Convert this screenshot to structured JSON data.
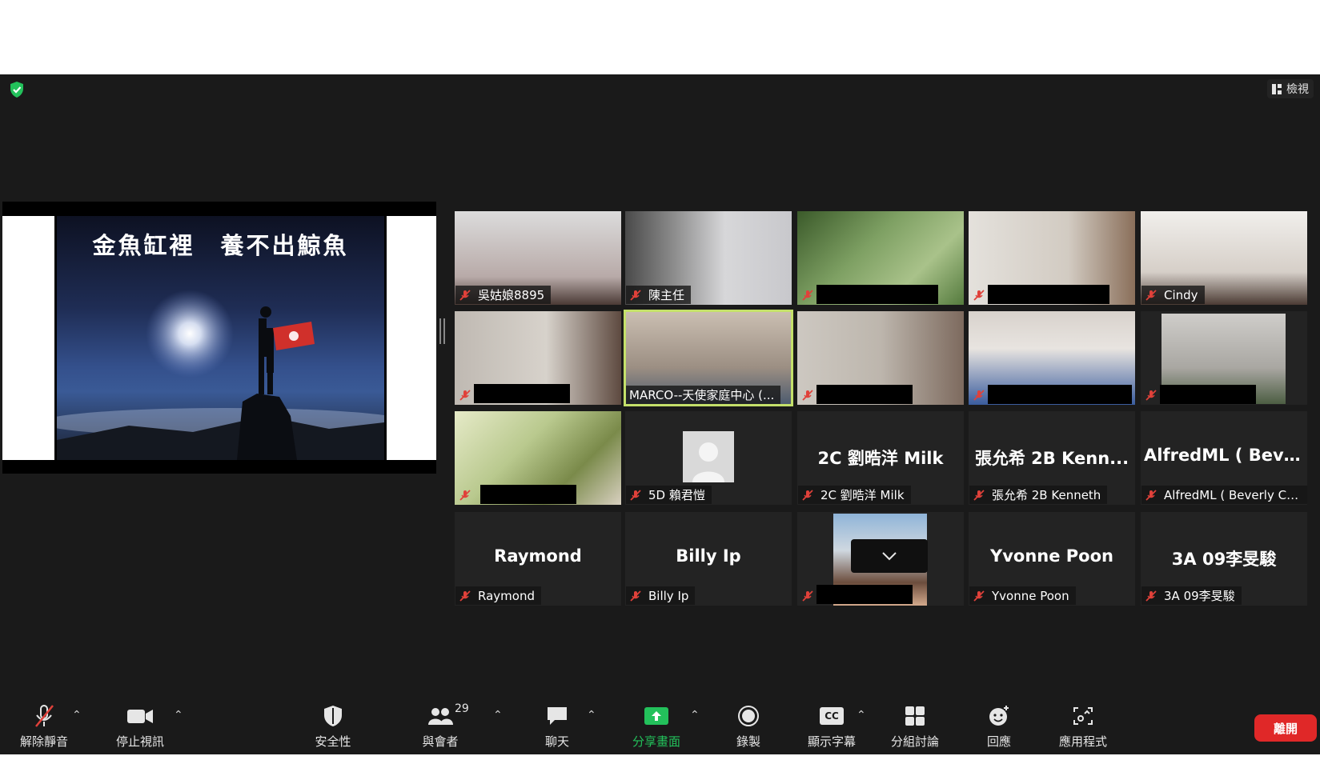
{
  "app": {
    "view_label": "檢視"
  },
  "share": {
    "slide_title": "金魚缸裡　養不出鯨魚"
  },
  "participants": [
    {
      "name": "吳姑娘8895"
    },
    {
      "name": "陳主任"
    },
    {
      "name": ""
    },
    {
      "name": ""
    },
    {
      "name": "Cindy"
    },
    {
      "name": ""
    },
    {
      "name": "MARCO--天使家庭中心 (..."
    },
    {
      "name": ""
    },
    {
      "name": ""
    },
    {
      "name": ""
    },
    {
      "name": ""
    },
    {
      "name": "5D 賴君愷"
    },
    {
      "name": "2C 劉晧洋 Milk",
      "big": "2C 劉晧洋 Milk"
    },
    {
      "name": "張允希 2B Kenneth",
      "big": "張允希 2B Kenn..."
    },
    {
      "name": "AlfredML ( Beverly Cha...",
      "big": "AlfredML ( Beve..."
    },
    {
      "name": "Raymond",
      "big": "Raymond"
    },
    {
      "name": "Billy Ip",
      "big": "Billy Ip"
    },
    {
      "name": ""
    },
    {
      "name": "Yvonne Poon",
      "big": "Yvonne Poon"
    },
    {
      "name": "3A 09李旻駿",
      "big": "3A 09李旻駿"
    }
  ],
  "toolbar": {
    "unmute": "解除靜音",
    "stop_video": "停止視訊",
    "security": "安全性",
    "participants": "與會者",
    "participant_count": "29",
    "chat": "聊天",
    "share_screen": "分享畫面",
    "record": "錄製",
    "captions": "顯示字幕",
    "captions_icon_text": "CC",
    "breakout": "分組討論",
    "reactions": "回應",
    "apps": "應用程式",
    "leave": "離開"
  },
  "colors": {
    "accent_green": "#23c15b",
    "leave_red": "#e02828",
    "active_speaker": "#c4e06a",
    "mute_red": "#e0413a"
  }
}
